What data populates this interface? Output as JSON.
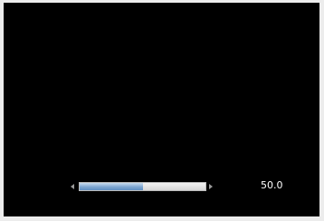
{
  "slider": {
    "value": 50.0,
    "min": 0,
    "max": 100,
    "value_label": "50.0",
    "fill_color": "#6f9acb",
    "track_color": "#e6e6e6"
  },
  "icons": {
    "decrease": "chevron-left-icon",
    "increase": "chevron-right-icon"
  }
}
